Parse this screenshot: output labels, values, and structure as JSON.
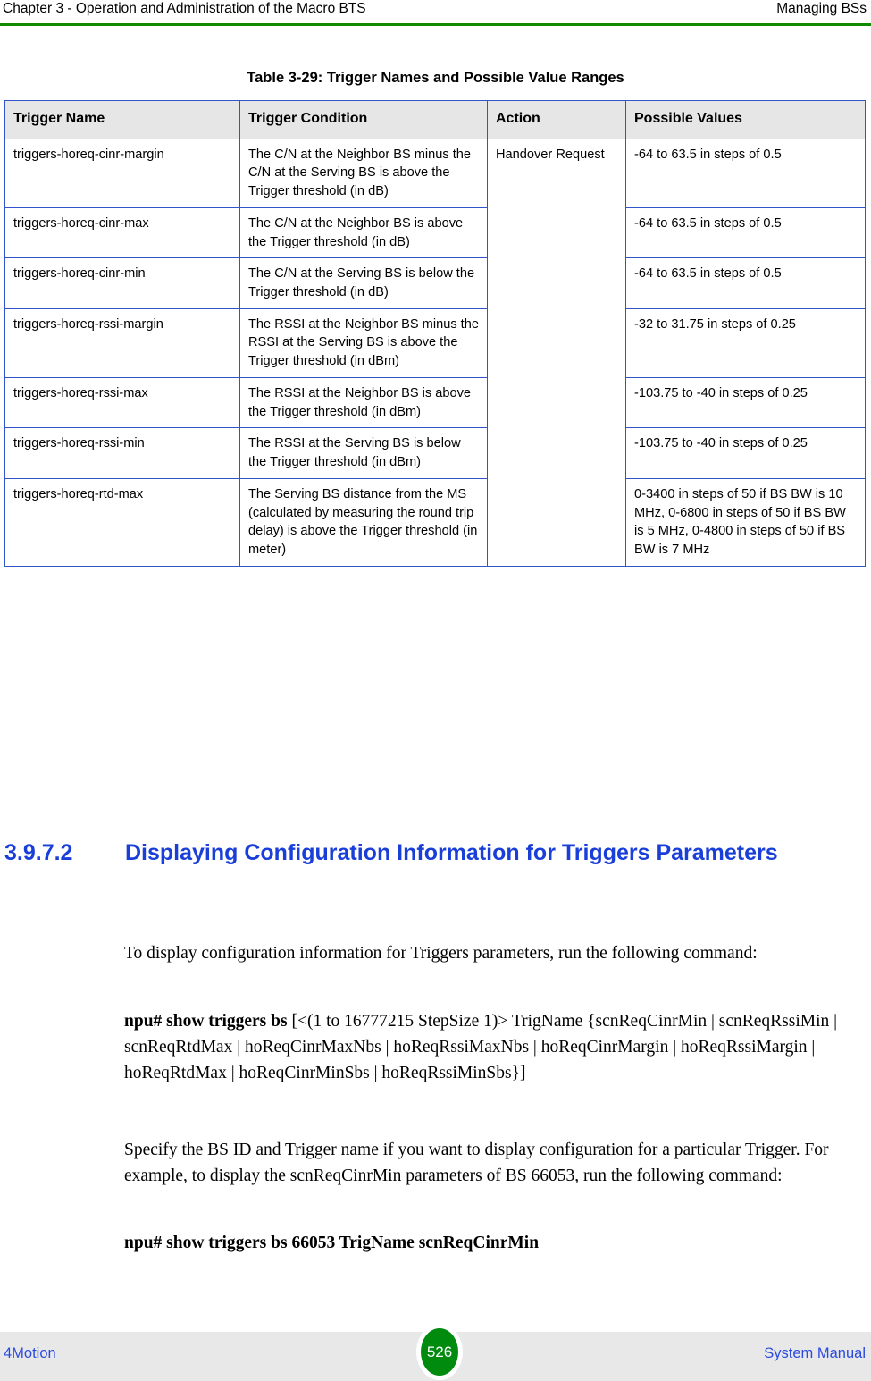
{
  "header": {
    "left": "Chapter 3 - Operation and Administration of the Macro BTS",
    "right": "Managing BSs",
    "rule_color": "#108A00"
  },
  "table": {
    "caption": "Table 3-29: Trigger Names and Possible Value Ranges",
    "columns": [
      "Trigger Name",
      "Trigger Condition",
      "Action",
      "Possible Values"
    ],
    "action_value": "Handover Request",
    "rows": [
      {
        "name": "triggers-horeq-cinr-margin",
        "condition": "The C/N at the Neighbor BS minus the C/N at the Serving BS is above the Trigger threshold (in dB)",
        "values": "-64 to 63.5 in steps of 0.5"
      },
      {
        "name": "triggers-horeq-cinr-max",
        "condition": "The C/N at the Neighbor BS is above the Trigger threshold (in dB)",
        "values": "-64 to 63.5 in steps of 0.5"
      },
      {
        "name": "triggers-horeq-cinr-min",
        "condition": "The C/N at the Serving BS is below the Trigger threshold (in dB)",
        "values": "-64 to 63.5 in steps of 0.5"
      },
      {
        "name": "triggers-horeq-rssi-margin",
        "condition": "The RSSI at the Neighbor BS minus the RSSI at the Serving BS is above the Trigger threshold (in dBm)",
        "values": "-32 to 31.75 in steps of 0.25"
      },
      {
        "name": "triggers-horeq-rssi-max",
        "condition": "The RSSI at the Neighbor BS is above the Trigger threshold (in dBm)",
        "values": "-103.75 to -40 in steps of 0.25"
      },
      {
        "name": "triggers-horeq-rssi-min",
        "condition": "The RSSI at the Serving BS is below the Trigger threshold (in dBm)",
        "values": "-103.75 to -40 in steps of 0.25"
      },
      {
        "name": "triggers-horeq-rtd-max",
        "condition": "The Serving BS distance from the MS (calculated by measuring the round trip delay) is above the Trigger threshold (in meter)",
        "values": "0-3400 in steps of 50 if BS BW is 10 MHz, 0-6800 in steps of 50 if BS BW is 5 MHz, 0-4800 in steps of 50 if BS BW is 7 MHz"
      }
    ]
  },
  "section": {
    "number": "3.9.7.2",
    "title": "Displaying Configuration Information for Triggers Parameters",
    "color": "#1A3FD9"
  },
  "body": {
    "paragraph_1": "To display configuration information for Triggers parameters, run the following command:",
    "command_syntax_bold": "npu# show triggers bs",
    "command_syntax_rest": " [<(1 to 16777215 StepSize 1)> TrigName {scnReqCinrMin | scnReqRssiMin | scnReqRtdMax | hoReqCinrMaxNbs | hoReqRssiMaxNbs | hoReqCinrMargin | hoReqRssiMargin | hoReqRtdMax | hoReqCinrMinSbs | hoReqRssiMinSbs}]",
    "paragraph_2": "Specify the BS ID and Trigger name if you want to display configuration for a particular Trigger. For example, to display the scnReqCinrMin parameters of BS 66053, run the following command:",
    "command_example": "npu# show triggers bs 66053 TrigName scnReqCinrMin"
  },
  "footer": {
    "left": "4Motion",
    "page_number": "526",
    "right": "System Manual",
    "badge_color": "#008A0E",
    "band_color": "#E8E8E8"
  }
}
